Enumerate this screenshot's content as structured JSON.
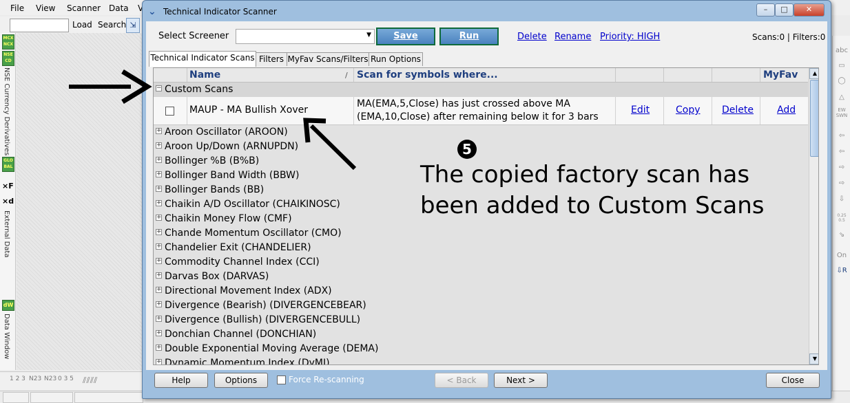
{
  "menubar": {
    "items": [
      "File",
      "View",
      "Scanner",
      "Data",
      "V"
    ]
  },
  "toolbar": {
    "load": "Load",
    "search": "Search"
  },
  "left_panel": {
    "badges": [
      {
        "top": "MCX",
        "bottom": "NCX"
      },
      {
        "top": "NSE",
        "bottom": "CD"
      },
      {
        "top": "GLO",
        "bottom": "BAL"
      }
    ],
    "vertical_labels": [
      "NSE Currency Derivatives",
      "External Data",
      "Data Window"
    ],
    "symbols": [
      "×F",
      "×d",
      "dW"
    ]
  },
  "right_panel": {
    "icons": [
      "abc",
      "▭",
      "◯",
      "△",
      "EW SWN",
      "⇦",
      "⇦",
      "⇨",
      "⇨",
      "⇩",
      "0.25 0.5",
      "⇘",
      "On",
      "⇩R"
    ]
  },
  "bottom_bar": {
    "icons": [
      "1 2 3",
      "N23",
      "N23",
      "0 3 5"
    ]
  },
  "dialog": {
    "title": "Technical Indicator Scanner",
    "window_buttons": [
      "–",
      "□",
      "✕"
    ],
    "select_screener_label": "Select Screener",
    "screener_value": "",
    "save": "Save",
    "run": "Run",
    "links": {
      "delete": "Delete",
      "rename": "Rename",
      "priority": "Priority: HIGH"
    },
    "counts": "Scans:0 | Filters:0",
    "tabs": [
      "Technical Indicator Scans",
      "Filters",
      "MyFav Scans/Filters",
      "Run Options"
    ],
    "grid": {
      "headers": {
        "name": "Name",
        "sort_indicator": "/",
        "scan": "Scan for symbols where...",
        "myfav": "MyFav"
      },
      "custom_group": "Custom Scans",
      "custom_scan": {
        "name": "MAUP - MA Bullish Xover",
        "condition_line1": "MA(EMA,5,Close) has just crossed above MA",
        "condition_line2": "(EMA,10,Close) after remaining below it for 3 bars",
        "edit": "Edit",
        "copy": "Copy",
        "delete": "Delete",
        "add": "Add"
      },
      "groups": [
        "Aroon Oscillator (AROON)",
        "Aroon Up/Down (ARNUPDN)",
        "Bollinger %B (B%B)",
        "Bollinger Band Width (BBW)",
        "Bollinger Bands (BB)",
        "Chaikin A/D Oscillator (CHAIKINOSC)",
        "Chaikin Money Flow (CMF)",
        "Chande Momentum Oscillator (CMO)",
        "Chandelier Exit (CHANDELIER)",
        "Commodity Channel Index (CCI)",
        "Darvas Box (DARVAS)",
        "Directional Movement Index (ADX)",
        "Divergence (Bearish) (DIVERGENCEBEAR)",
        "Divergence (Bullish) (DIVERGENCEBULL)",
        "Donchian Channel (DONCHIAN)",
        "Double Exponential Moving Average (DEMA)",
        "Dynamic Momentum Index (DyMI)"
      ]
    },
    "buttons": {
      "help": "Help",
      "options": "Options",
      "force_rescanning": "Force Re-scanning",
      "back": "< Back",
      "next": "Next >",
      "close": "Close"
    }
  },
  "annotation": {
    "step_number": "5",
    "caption_line1": "The copied factory scan has",
    "caption_line2": "been added to Custom Scans"
  }
}
